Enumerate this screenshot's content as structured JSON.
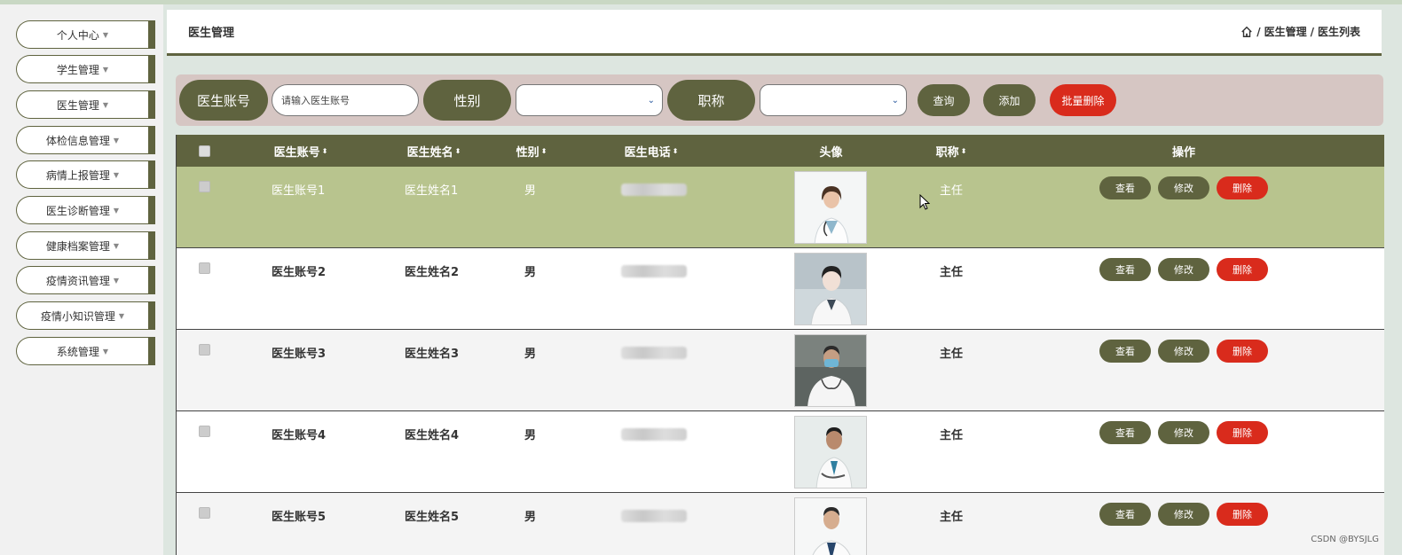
{
  "sidebar": {
    "items": [
      {
        "label": "个人中心"
      },
      {
        "label": "学生管理"
      },
      {
        "label": "医生管理"
      },
      {
        "label": "体检信息管理"
      },
      {
        "label": "病情上报管理"
      },
      {
        "label": "医生诊断管理"
      },
      {
        "label": "健康档案管理"
      },
      {
        "label": "疫情资讯管理"
      },
      {
        "label": "疫情小知识管理"
      },
      {
        "label": "系统管理"
      }
    ]
  },
  "header": {
    "title": "医生管理",
    "breadcrumb": [
      "医生管理",
      "医生列表"
    ],
    "separator": "/"
  },
  "search": {
    "account_label": "医生账号",
    "account_placeholder": "请输入医生账号",
    "gender_label": "性别",
    "title_label": "职称",
    "query_button": "查询",
    "add_button": "添加",
    "batch_delete_button": "批量删除"
  },
  "table": {
    "headers": {
      "account": "医生账号",
      "name": "医生姓名",
      "gender": "性别",
      "phone": "医生电话",
      "avatar": "头像",
      "title": "职称",
      "actions": "操作"
    },
    "rows": [
      {
        "account": "医生账号1",
        "name": "医生姓名1",
        "gender": "男",
        "title": "主任"
      },
      {
        "account": "医生账号2",
        "name": "医生姓名2",
        "gender": "男",
        "title": "主任"
      },
      {
        "account": "医生账号3",
        "name": "医生姓名3",
        "gender": "男",
        "title": "主任"
      },
      {
        "account": "医生账号4",
        "name": "医生姓名4",
        "gender": "男",
        "title": "主任"
      },
      {
        "account": "医生账号5",
        "name": "医生姓名5",
        "gender": "男",
        "title": "主任"
      }
    ],
    "actions": {
      "view": "查看",
      "edit": "修改",
      "delete": "删除"
    }
  },
  "watermark": "CSDN @BYSJLG",
  "colors": {
    "accent": "#5f633f",
    "danger": "#d92b1c",
    "highlight_row": "#b8c48e"
  },
  "icons": {
    "home": "home-icon",
    "sort": "sort-icon",
    "caret": "caret-down-icon"
  }
}
